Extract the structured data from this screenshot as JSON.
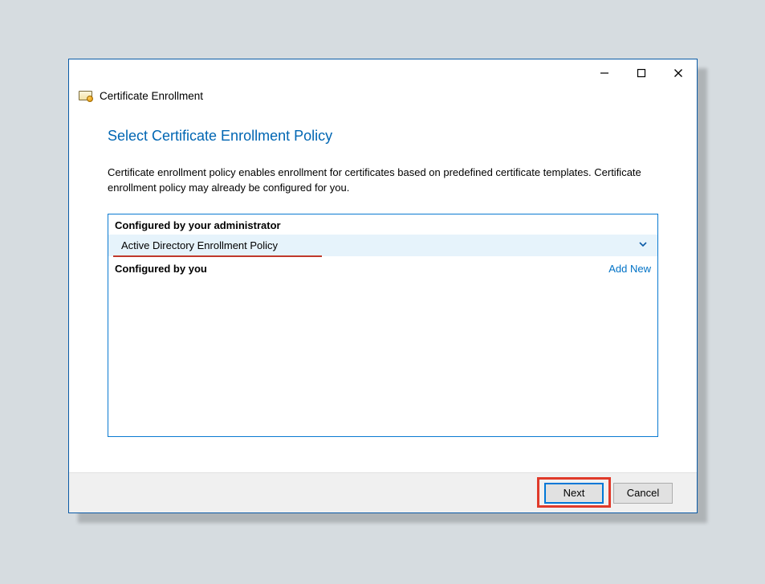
{
  "window": {
    "header_title": "Certificate Enrollment"
  },
  "page": {
    "title": "Select Certificate Enrollment Policy",
    "description": "Certificate enrollment policy enables enrollment for certificates based on predefined certificate templates. Certificate enrollment policy may already be configured for you."
  },
  "sections": {
    "admin_label": "Configured by your administrator",
    "admin_policy": "Active Directory Enrollment Policy",
    "you_label": "Configured by you",
    "add_new": "Add New"
  },
  "buttons": {
    "next": "Next",
    "cancel": "Cancel"
  }
}
